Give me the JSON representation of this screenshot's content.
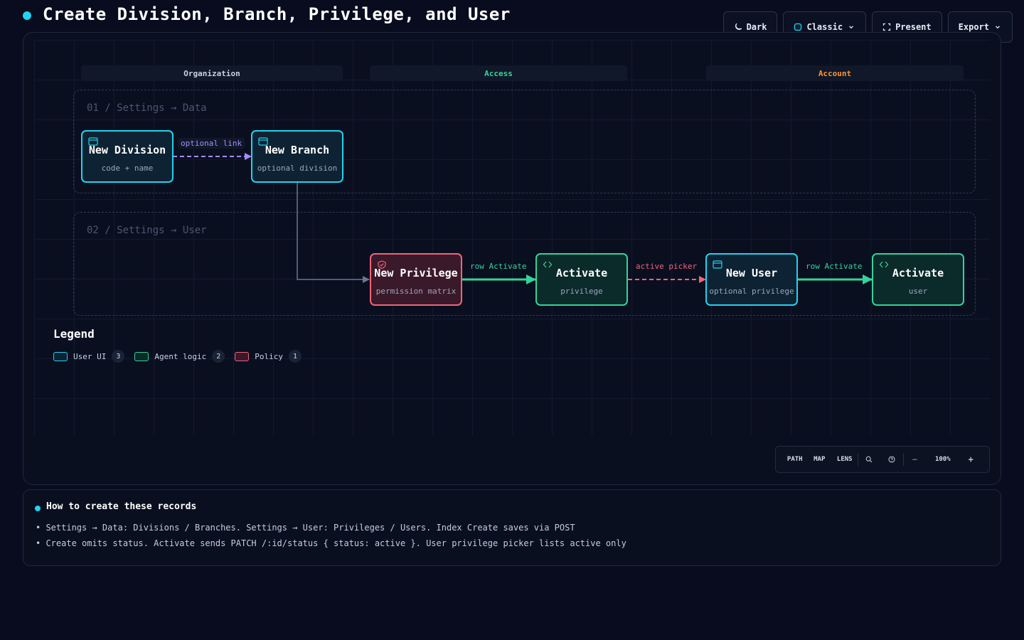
{
  "header": {
    "title": "Create Division, Branch, Privilege, and User"
  },
  "toolbar": {
    "dark_label": "Dark",
    "theme_label": "Classic",
    "present_label": "Present",
    "export_label": "Export"
  },
  "lanes": [
    {
      "label": "Organization",
      "color": "#c9d2e3"
    },
    {
      "label": "Access",
      "color": "#34d399"
    },
    {
      "label": "Account",
      "color": "#fb923c"
    }
  ],
  "stages": [
    {
      "label": "01 / Settings → Data"
    },
    {
      "label": "02 / Settings → User"
    }
  ],
  "nodes": [
    {
      "title": "New Division",
      "sub": "code + name",
      "kind": "user-ui",
      "icon": "window-icon"
    },
    {
      "title": "New Branch",
      "sub": "optional division",
      "kind": "user-ui",
      "icon": "window-icon"
    },
    {
      "title": "New Privilege",
      "sub": "permission matrix",
      "kind": "policy",
      "icon": "shield-icon"
    },
    {
      "title": "Activate",
      "sub": "privilege",
      "kind": "agent",
      "icon": "code-icon"
    },
    {
      "title": "New User",
      "sub": "optional privilege",
      "kind": "user-ui",
      "icon": "window-icon"
    },
    {
      "title": "Activate",
      "sub": "user",
      "kind": "agent",
      "icon": "code-icon"
    }
  ],
  "edges": [
    {
      "label": "optional link",
      "color": "#a78bfa",
      "style": "dashed"
    },
    {
      "label": "",
      "color": "#6b7690",
      "style": "solid"
    },
    {
      "label": "row Activate",
      "color": "#34d399",
      "style": "solid"
    },
    {
      "label": "active picker",
      "color": "#f0647a",
      "style": "dashed"
    },
    {
      "label": "row Activate",
      "color": "#34d399",
      "style": "solid"
    }
  ],
  "legend": {
    "title": "Legend",
    "items": [
      {
        "label": "User UI",
        "count": "3",
        "color": "#22d3ee"
      },
      {
        "label": "Agent logic",
        "count": "2",
        "color": "#34d399"
      },
      {
        "label": "Policy",
        "count": "1",
        "color": "#f0647a"
      }
    ]
  },
  "zoombar": {
    "path": "PATH",
    "map": "MAP",
    "lens": "LENS",
    "zoom": "100%",
    "minus": "−",
    "plus": "+"
  },
  "notes": {
    "title": "How to create these records",
    "lines": [
      "• Settings → Data: Divisions / Branches. Settings → User: Privileges / Users. Index Create saves via POST",
      "• Create omits status. Activate sends PATCH /:id/status { status: active }. User privilege picker lists active only"
    ]
  },
  "colors": {
    "accent": "#22d3ee",
    "agent": "#34d399",
    "policy": "#f0647a",
    "optional": "#a78bfa",
    "account": "#fb923c"
  }
}
